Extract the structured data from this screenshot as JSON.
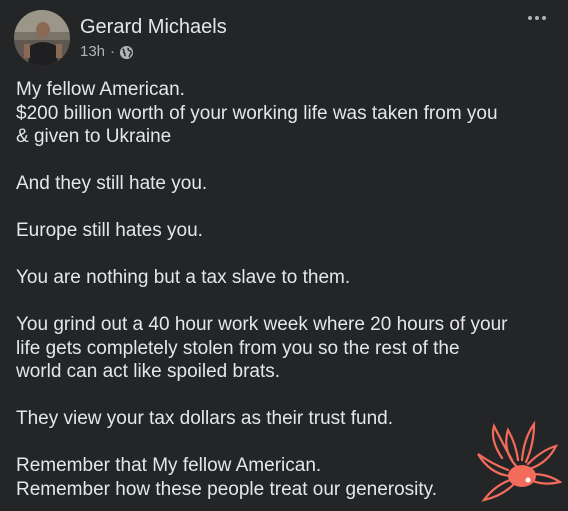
{
  "post": {
    "author": "Gerard Michaels",
    "time": "13h",
    "separator": "·",
    "privacy_icon": "globe-icon",
    "more_icon": "more-options-icon",
    "paragraphs": [
      [
        "My fellow American.",
        "$200 billion worth of your working life was taken from you",
        "& given to Ukraine"
      ],
      [
        "And they still hate you."
      ],
      [
        "Europe still hates you."
      ],
      [
        "You are nothing but a tax slave to them."
      ],
      [
        "You grind out a 40 hour work week where 20 hours of your",
        "life gets completely stolen from you so the rest of the",
        "world can act like spoiled brats."
      ],
      [
        "They view your tax dollars as their trust fund."
      ],
      [
        "Remember that My fellow American.",
        "Remember how these people treat our generosity."
      ]
    ]
  },
  "colors": {
    "background": "#242526",
    "primary_text": "#e4e6eb",
    "secondary_text": "#b0b3b8",
    "sticker_accent": "#f26b5b"
  },
  "sticker": {
    "icon": "flower-doodle-icon"
  }
}
